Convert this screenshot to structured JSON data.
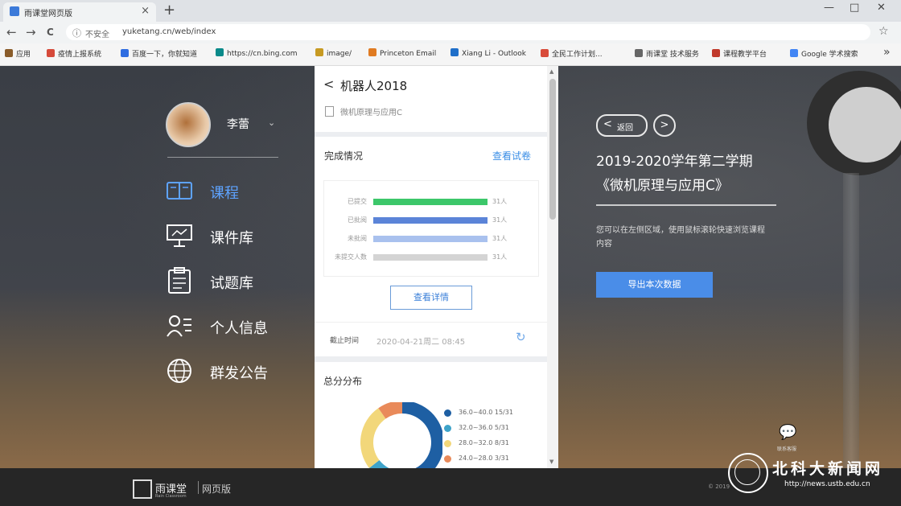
{
  "browser": {
    "tab_title": "雨课堂网页版",
    "tab_close": "×",
    "new_tab": "+",
    "win_min": "—",
    "win_max": "□",
    "win_close": "✕",
    "nav_back": "←",
    "nav_forward": "→",
    "nav_reload": "C",
    "security_icon": "ⓘ",
    "security_text": "不安全",
    "url": "yuketang.cn/web/index",
    "bookmark_star": "☆",
    "bookmarks_more": "»",
    "bookmarks": [
      {
        "label": "应用",
        "icon": "apps-icon",
        "color": "#8a5c2a"
      },
      {
        "label": "疫情上报系统",
        "icon": "report-icon",
        "color": "#d64a3a"
      },
      {
        "label": "百度一下，你就知道",
        "icon": "baidu-paw-icon",
        "color": "#2f6de1"
      },
      {
        "label": "https://cn.bing.com",
        "icon": "bing-icon",
        "color": "#0a8a8a"
      },
      {
        "label": "image/",
        "icon": "image-icon",
        "color": "#c79a22"
      },
      {
        "label": "Princeton Email",
        "icon": "princeton-icon",
        "color": "#e07b22"
      },
      {
        "label": "Xiang Li - Outlook",
        "icon": "outlook-icon",
        "color": "#1f6fc9"
      },
      {
        "label": "全民工作计划...",
        "icon": "plan-icon",
        "color": "#d84b3a"
      },
      {
        "label": "雨课堂 技术服务",
        "icon": "globe-icon",
        "color": "#666666"
      },
      {
        "label": "课程教学平台",
        "icon": "course-icon",
        "color": "#c0392b"
      },
      {
        "label": "Google 学术搜索",
        "icon": "google-scholar-icon",
        "color": "#4285f4"
      }
    ]
  },
  "user": {
    "name": "李蕾",
    "chevron": "⌄"
  },
  "nav": [
    {
      "label": "课程",
      "icon": "course-book-icon",
      "active": true
    },
    {
      "label": "课件库",
      "icon": "slides-icon",
      "active": false
    },
    {
      "label": "试题库",
      "icon": "question-bank-icon",
      "active": false
    },
    {
      "label": "个人信息",
      "icon": "profile-icon",
      "active": false
    },
    {
      "label": "群发公告",
      "icon": "broadcast-globe-icon",
      "active": false
    }
  ],
  "panel": {
    "back_icon": "<",
    "course_title": "机器人2018",
    "course_subtitle": "微机原理与应用C",
    "stats_title": "完成情况",
    "view_exam": "查看试卷",
    "bars": [
      {
        "label": "已提交",
        "count": "31人",
        "fraction": 1.0,
        "color": "#3cc76a"
      },
      {
        "label": "已批阅",
        "count": "31人",
        "fraction": 1.0,
        "color": "#5b84d8"
      },
      {
        "label": "未批阅",
        "count": "31人",
        "fraction": 1.0,
        "color": "#a9c1ee"
      },
      {
        "label": "未提交人数",
        "count": "31人",
        "fraction": 1.0,
        "color": "#d4d4d4"
      }
    ],
    "detail_button": "查看详情",
    "deadline_label": "截止时间",
    "deadline_value": "2020-04-21周二 08:45",
    "share_icon": "↻",
    "dist_title": "总分分布",
    "distribution": [
      {
        "range": "36.0~40.0",
        "count": "15/31",
        "value": 15,
        "color": "#1e5fa3"
      },
      {
        "range": "32.0~36.0",
        "count": "5/31",
        "value": 5,
        "color": "#3ea3c9"
      },
      {
        "range": "28.0~32.0",
        "count": "8/31",
        "value": 8,
        "color": "#f2d77a"
      },
      {
        "range": "24.0~28.0",
        "count": "3/31",
        "value": 3,
        "color": "#e98a5a"
      }
    ],
    "scroll_up": "▲",
    "scroll_down": "▼"
  },
  "right": {
    "back_label": "返回",
    "back_arrow": "<",
    "next_arrow": ">",
    "term_line1": "2019-2020学年第二学期",
    "term_line2": "《微机原理与应用C》",
    "description": "您可以在左侧区域，使用鼠标滚轮快速浏览课程内容",
    "export_button": "导出本次数据",
    "wechat_icon": "💬",
    "wechat_label": "联系客服"
  },
  "footer": {
    "brand": "雨课堂",
    "brand_sub": "Rain Classroom",
    "web_version": "网页版",
    "copyright": "© 2019"
  },
  "watermark": {
    "title": "北科大新闻网",
    "url": "http://news.ustb.edu.cn"
  }
}
